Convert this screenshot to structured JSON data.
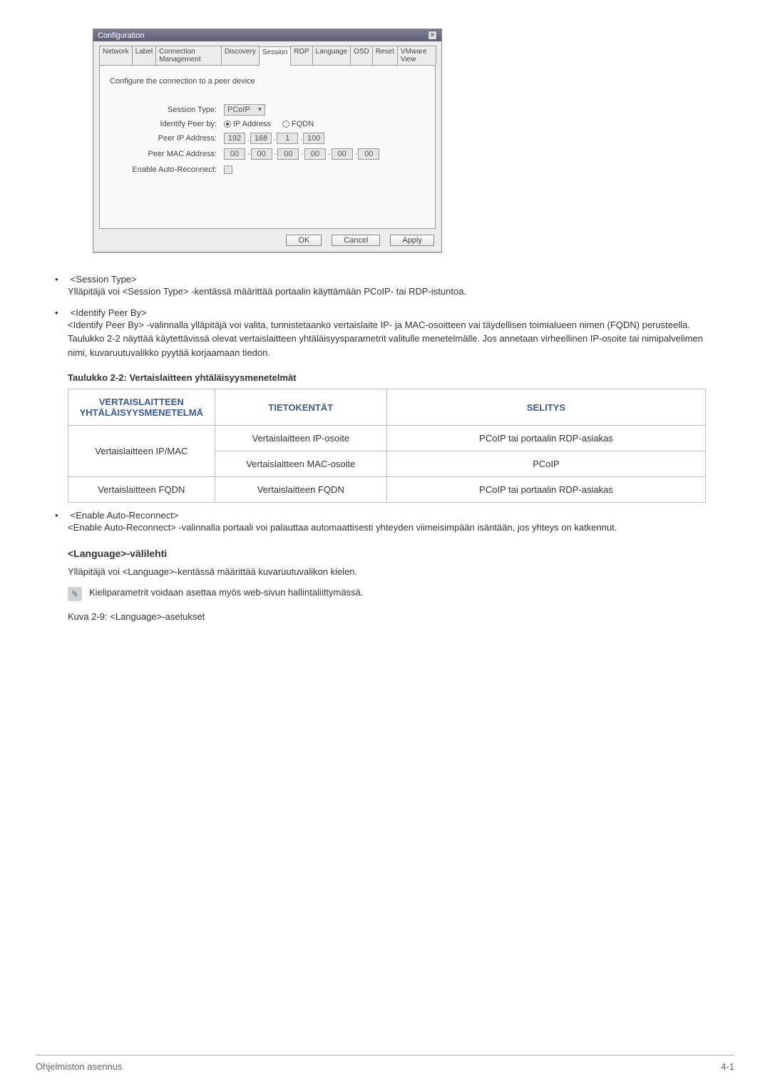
{
  "dialog": {
    "title": "Configuration",
    "tabs": [
      "Network",
      "Label",
      "Connection Management",
      "Discovery",
      "Session",
      "RDP",
      "Language",
      "OSD",
      "Reset",
      "VMware View"
    ],
    "active_tab": 4,
    "panel_desc": "Configure the connection to a peer device",
    "labels": {
      "session_type": "Session Type:",
      "identify_peer_by": "Identify Peer by:",
      "peer_ip": "Peer IP Address:",
      "peer_mac": "Peer MAC Address:",
      "auto_reconnect": "Enable Auto-Reconnect:"
    },
    "session_type_value": "PCoIP",
    "radio_ip": "IP Address",
    "radio_fqdn": "FQDN",
    "ip": [
      "192",
      "168",
      "1",
      "100"
    ],
    "mac": [
      "00",
      "00",
      "00",
      "00",
      "00",
      "00"
    ],
    "buttons": {
      "ok": "OK",
      "cancel": "Cancel",
      "apply": "Apply"
    }
  },
  "bullets_top": [
    {
      "head": "<Session Type>",
      "body": "Ylläpitäjä voi <Session Type> -kentässä määrittää portaalin käyttämään PCoIP- tai RDP-istuntoa."
    },
    {
      "head": "<Identify Peer By>",
      "body": "<Identify Peer By> -valinnalla ylläpitäjä voi valita, tunnistetaanko vertaislaite IP- ja MAC-osoitteen vai täydellisen toimialueen nimen (FQDN) perusteella.\nTaulukko 2-2 näyttää käytettävissä olevat vertaislaitteen yhtäläisyysparametrit valitulle menetelmälle. Jos annetaan virheellinen IP-osoite tai nimipalvelimen nimi, kuvaruutuvalikko pyytää korjaamaan tiedon."
    }
  ],
  "table": {
    "caption": "Taulukko 2-2: Vertaislaitteen yhtäläisyysmenetelmät",
    "headers": [
      "VERTAISLAITTEEN YHTÄLÄISYYSMENETELMÄ",
      "TIETOKENTÄT",
      "SELITYS"
    ],
    "rows": [
      {
        "method": "Vertaislaitteen IP/MAC",
        "field": "Vertaislaitteen IP-osoite",
        "desc": "PCoIP tai portaalin RDP-asiakas"
      },
      {
        "method": "",
        "field": "Vertaislaitteen MAC-osoite",
        "desc": "PCoIP"
      },
      {
        "method": "Vertaislaitteen FQDN",
        "field": "Vertaislaitteen FQDN",
        "desc": "PCoIP tai portaalin RDP-asiakas"
      }
    ]
  },
  "bullets_mid": [
    {
      "head": "<Enable Auto-Reconnect>",
      "body": "<Enable Auto-Reconnect> -valinnalla portaali voi palauttaa automaattisesti yhteyden viimeisimpään isäntään, jos yhteys on katkennut."
    }
  ],
  "language": {
    "heading": "<Language>-välilehti",
    "para": "Ylläpitäjä voi <Language>-kentässä määrittää kuvaruutuvalikon kielen.",
    "note": "Kieliparametrit voidaan asettaa myös web-sivun hallintaliittymässä.",
    "fig": "Kuva 2-9: <Language>-asetukset"
  },
  "footer": {
    "left": "Ohjelmiston asennus",
    "right": "4-1"
  }
}
